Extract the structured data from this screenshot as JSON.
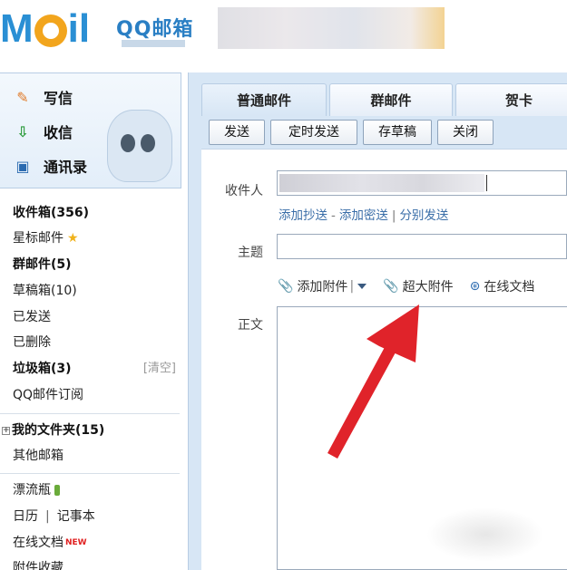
{
  "header": {
    "logo_text": "MOil",
    "title": "QQ邮箱"
  },
  "sidebar": {
    "quick": {
      "write": "写信",
      "receive": "收信",
      "contacts": "通讯录"
    },
    "folders": {
      "inbox": "收件箱(356)",
      "starred": "星标邮件",
      "group": "群邮件(5)",
      "drafts": "草稿箱(10)",
      "sent": "已发送",
      "deleted": "已删除",
      "trash": "垃圾箱(3)",
      "trash_clear": "[清空]",
      "subscribe": "QQ邮件订阅",
      "my_folders": "我的文件夹(15)",
      "other_mail": "其他邮箱",
      "bottle": "漂流瓶",
      "calendar": "日历",
      "notepad": "记事本",
      "online_docs": "在线文档",
      "new_badge": "NEW",
      "attachments": "附件收藏"
    }
  },
  "tabs": {
    "normal": "普通邮件",
    "group": "群邮件",
    "card": "贺卡"
  },
  "toolbar": {
    "send": "发送",
    "timed_send": "定时发送",
    "save_draft": "存草稿",
    "close": "关闭"
  },
  "compose": {
    "to_label": "收件人",
    "add_cc": "添加抄送",
    "dash": "-",
    "add_bcc": "添加密送",
    "pipe": "|",
    "separate_send": "分别发送",
    "subject_label": "主题",
    "add_attachment": "添加附件",
    "large_attachment": "超大附件",
    "online_doc": "在线文档",
    "body_label": "正文"
  },
  "colors": {
    "accent_blue": "#2a8fd4",
    "panel_bg": "#d7e6f5",
    "link_blue": "#3a6ea8",
    "arrow_red": "#e0232a"
  },
  "icons": {
    "write": "pencil-icon",
    "receive": "inbox-download-icon",
    "contacts": "address-book-icon",
    "star": "star-icon",
    "attachment": "paperclip-icon",
    "large_attachment": "gold-paperclip-icon",
    "online_doc": "share-icon"
  }
}
